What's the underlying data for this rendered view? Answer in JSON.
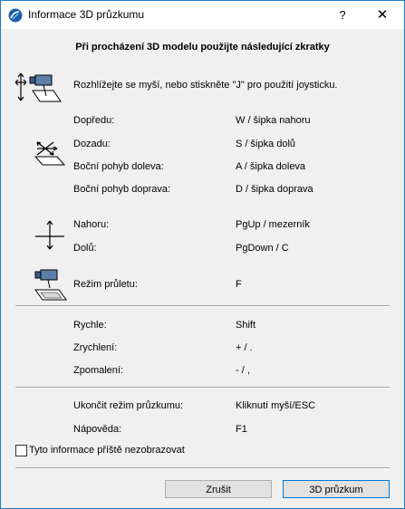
{
  "window": {
    "title": "Informace 3D průzkumu",
    "help_glyph": "?",
    "close_glyph": "✕"
  },
  "content": {
    "heading": "Při procházení 3D modelu použijte následující zkratky",
    "intro": "Rozhlížejte se myší, nebo stiskněte \"J\" pro použití joysticku.",
    "movement": [
      {
        "label": "Dopředu:",
        "value": "W / šipka nahoru"
      },
      {
        "label": "Dozadu:",
        "value": "S / šipka dolů"
      },
      {
        "label": "Boční pohyb doleva:",
        "value": "A / šipka doleva"
      },
      {
        "label": "Boční pohyb doprava:",
        "value": "D / šipka doprava"
      }
    ],
    "vertical": [
      {
        "label": "Nahoru:",
        "value": "PgUp / mezerník"
      },
      {
        "label": "Dolů:",
        "value": "PgDown / C"
      }
    ],
    "flight": {
      "label": "Režim průletu:",
      "value": "F"
    },
    "speed": [
      {
        "label": "Rychle:",
        "value": "Shift"
      },
      {
        "label": "Zrychlení:",
        "value": "+ / ."
      },
      {
        "label": "Zpomalení:",
        "value": "- / ,"
      }
    ],
    "other": [
      {
        "label": "Ukončit režim průzkumu:",
        "value": "Kliknutí myší/ESC"
      },
      {
        "label": "Nápověda:",
        "value": "F1"
      }
    ],
    "checkbox_label": "Tyto informace příště nezobrazovat",
    "checkbox_checked": false
  },
  "buttons": {
    "cancel": "Zrušit",
    "explore": "3D průzkum"
  },
  "colors": {
    "window_border": "#1e7bc6",
    "button_focus": "#0078d7"
  }
}
